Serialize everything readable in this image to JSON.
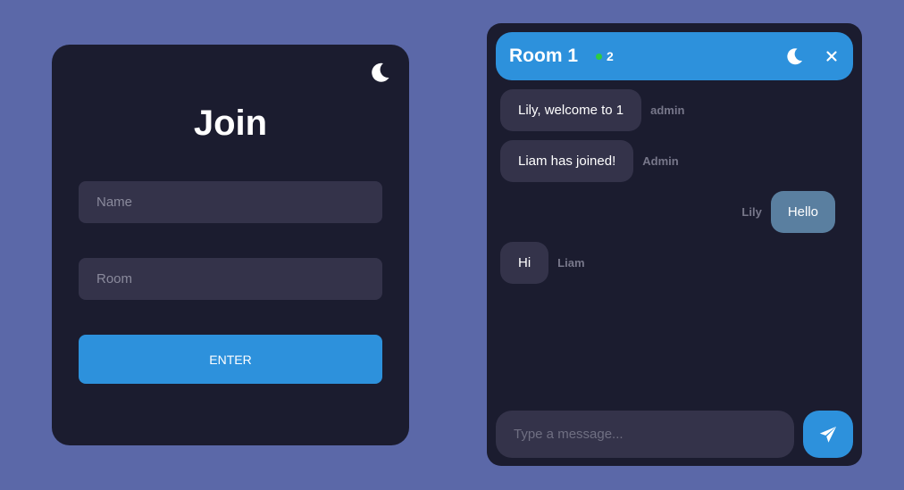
{
  "join": {
    "title": "Join",
    "name_placeholder": "Name",
    "room_placeholder": "Room",
    "enter_label": "ENTER",
    "theme_icon": "moon-icon"
  },
  "chat": {
    "header": {
      "room_name": "Room 1",
      "online_count": "2",
      "online_color": "#2ecc40",
      "theme_icon": "moon-icon",
      "close_icon": "close-icon"
    },
    "messages": [
      {
        "text": "Lily, welcome to 1",
        "sender": "admin",
        "side": "left"
      },
      {
        "text": "Liam has joined!",
        "sender": "Admin",
        "side": "left"
      },
      {
        "text": "Hello",
        "sender": "Lily",
        "side": "right"
      },
      {
        "text": "Hi",
        "sender": "Liam",
        "side": "left"
      }
    ],
    "composer": {
      "placeholder": "Type a message...",
      "value": "",
      "send_icon": "paper-plane-icon"
    }
  },
  "colors": {
    "background": "#5b68a8",
    "card": "#1b1c2f",
    "accent": "#2d91dc",
    "input": "#34334a",
    "outgoing_bubble": "#5a7fa0"
  }
}
